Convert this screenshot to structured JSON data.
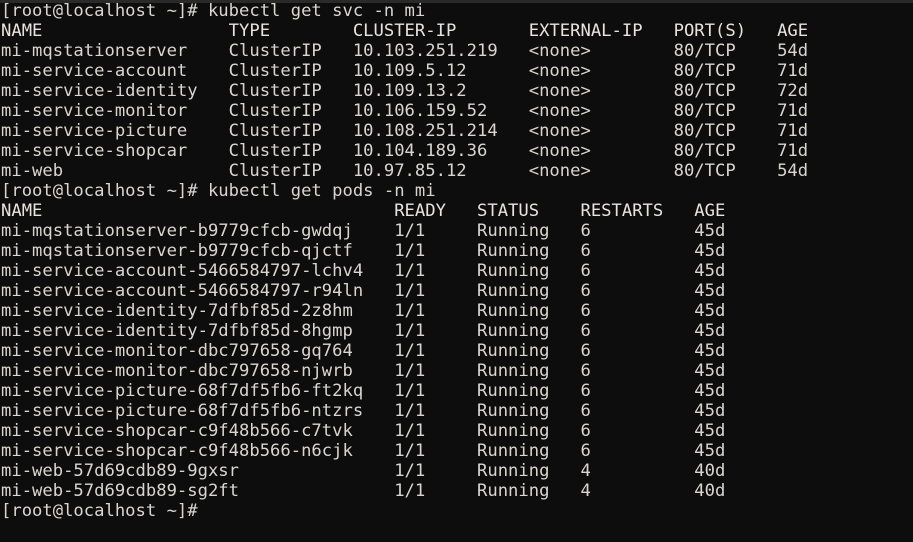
{
  "terminal": {
    "title": "root@localhost terminal",
    "background_color": "#0d0d0d",
    "foreground_color": "#d8d6cf",
    "prompt": "[root@localhost ~]#",
    "columns_per_row": 90
  },
  "commands": {
    "svc_command": "kubectl get svc -n mi",
    "pods_command": "kubectl get pods -n mi"
  },
  "lines": {
    "l00": "[root@localhost ~]# kubectl get svc -n mi",
    "l01": "NAME                  TYPE        CLUSTER-IP       EXTERNAL-IP   PORT(S)   AGE",
    "l02": "mi-mqstationserver    ClusterIP   10.103.251.219   <none>        80/TCP    54d",
    "l03": "mi-service-account    ClusterIP   10.109.5.12      <none>        80/TCP    71d",
    "l04": "mi-service-identity   ClusterIP   10.109.13.2      <none>        80/TCP    72d",
    "l05": "mi-service-monitor    ClusterIP   10.106.159.52    <none>        80/TCP    71d",
    "l06": "mi-service-picture    ClusterIP   10.108.251.214   <none>        80/TCP    71d",
    "l07": "mi-service-shopcar    ClusterIP   10.104.189.36    <none>        80/TCP    71d",
    "l08": "mi-web                ClusterIP   10.97.85.12      <none>        80/TCP    54d",
    "l09": "[root@localhost ~]# kubectl get pods -n mi",
    "l10": "NAME                                  READY   STATUS    RESTARTS   AGE",
    "l11": "mi-mqstationserver-b9779cfcb-gwdqj    1/1     Running   6          45d",
    "l12": "mi-mqstationserver-b9779cfcb-qjctf    1/1     Running   6          45d",
    "l13": "mi-service-account-5466584797-lchv4   1/1     Running   6          45d",
    "l14": "mi-service-account-5466584797-r94ln   1/1     Running   6          45d",
    "l15": "mi-service-identity-7dfbf85d-2z8hm    1/1     Running   6          45d",
    "l16": "mi-service-identity-7dfbf85d-8hgmp    1/1     Running   6          45d",
    "l17": "mi-service-monitor-dbc797658-gq764    1/1     Running   6          45d",
    "l18": "mi-service-monitor-dbc797658-njwrb    1/1     Running   6          45d",
    "l19": "mi-service-picture-68f7df5fb6-ft2kq   1/1     Running   6          45d",
    "l20": "mi-service-picture-68f7df5fb6-ntzrs   1/1     Running   6          45d",
    "l21": "mi-service-shopcar-c9f48b566-c7tvk    1/1     Running   6          45d",
    "l22": "mi-service-shopcar-c9f48b566-n6cjk    1/1     Running   6          45d",
    "l23": "mi-web-57d69cdb89-9gxsr               1/1     Running   4          40d",
    "l24": "mi-web-57d69cdb89-sg2ft               1/1     Running   4          40d",
    "l25": "[root@localhost ~]#"
  },
  "services_table": {
    "headers": [
      "NAME",
      "TYPE",
      "CLUSTER-IP",
      "EXTERNAL-IP",
      "PORT(S)",
      "AGE"
    ],
    "rows": [
      [
        "mi-mqstationserver",
        "ClusterIP",
        "10.103.251.219",
        "<none>",
        "80/TCP",
        "54d"
      ],
      [
        "mi-service-account",
        "ClusterIP",
        "10.109.5.12",
        "<none>",
        "80/TCP",
        "71d"
      ],
      [
        "mi-service-identity",
        "ClusterIP",
        "10.109.13.2",
        "<none>",
        "80/TCP",
        "72d"
      ],
      [
        "mi-service-monitor",
        "ClusterIP",
        "10.106.159.52",
        "<none>",
        "80/TCP",
        "71d"
      ],
      [
        "mi-service-picture",
        "ClusterIP",
        "10.108.251.214",
        "<none>",
        "80/TCP",
        "71d"
      ],
      [
        "mi-service-shopcar",
        "ClusterIP",
        "10.104.189.36",
        "<none>",
        "80/TCP",
        "71d"
      ],
      [
        "mi-web",
        "ClusterIP",
        "10.97.85.12",
        "<none>",
        "80/TCP",
        "54d"
      ]
    ]
  },
  "pods_table": {
    "headers": [
      "NAME",
      "READY",
      "STATUS",
      "RESTARTS",
      "AGE"
    ],
    "rows": [
      [
        "mi-mqstationserver-b9779cfcb-gwdqj",
        "1/1",
        "Running",
        "6",
        "45d"
      ],
      [
        "mi-mqstationserver-b9779cfcb-qjctf",
        "1/1",
        "Running",
        "6",
        "45d"
      ],
      [
        "mi-service-account-5466584797-lchv4",
        "1/1",
        "Running",
        "6",
        "45d"
      ],
      [
        "mi-service-account-5466584797-r94ln",
        "1/1",
        "Running",
        "6",
        "45d"
      ],
      [
        "mi-service-identity-7dfbf85d-2z8hm",
        "1/1",
        "Running",
        "6",
        "45d"
      ],
      [
        "mi-service-identity-7dfbf85d-8hgmp",
        "1/1",
        "Running",
        "6",
        "45d"
      ],
      [
        "mi-service-monitor-dbc797658-gq764",
        "1/1",
        "Running",
        "6",
        "45d"
      ],
      [
        "mi-service-monitor-dbc797658-njwrb",
        "1/1",
        "Running",
        "6",
        "45d"
      ],
      [
        "mi-service-picture-68f7df5fb6-ft2kq",
        "1/1",
        "Running",
        "6",
        "45d"
      ],
      [
        "mi-service-picture-68f7df5fb6-ntzrs",
        "1/1",
        "Running",
        "6",
        "45d"
      ],
      [
        "mi-service-shopcar-c9f48b566-c7tvk",
        "1/1",
        "Running",
        "6",
        "45d"
      ],
      [
        "mi-service-shopcar-c9f48b566-n6cjk",
        "1/1",
        "Running",
        "6",
        "45d"
      ],
      [
        "mi-web-57d69cdb89-9gxsr",
        "1/1",
        "Running",
        "4",
        "40d"
      ],
      [
        "mi-web-57d69cdb89-sg2ft",
        "1/1",
        "Running",
        "4",
        "40d"
      ]
    ]
  }
}
